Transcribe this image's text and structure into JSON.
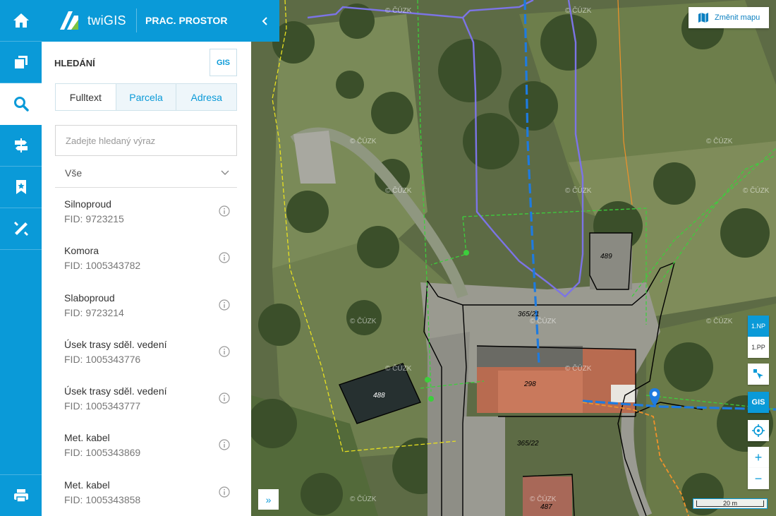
{
  "app": {
    "brand": "twiGIS",
    "workspace": "PRAC. PROSTOR"
  },
  "rail": [
    {
      "name": "home-icon"
    },
    {
      "name": "layers-icon"
    },
    {
      "name": "search-icon"
    },
    {
      "name": "signpost-icon"
    },
    {
      "name": "bookmark-icon"
    },
    {
      "name": "measure-icon"
    },
    {
      "name": "print-icon"
    }
  ],
  "panel": {
    "title": "HLEDÁNÍ",
    "gis_button": "GIS",
    "tabs": [
      "Fulltext",
      "Parcela",
      "Adresa"
    ],
    "search": {
      "placeholder": "Zadejte hledaný výraz",
      "value": ""
    },
    "filter": "Vše",
    "results": [
      {
        "title": "Silnoproud",
        "fid": "FID: 9723215"
      },
      {
        "title": "Komora",
        "fid": "FID: 1005343782"
      },
      {
        "title": "Slaboproud",
        "fid": "FID: 9723214"
      },
      {
        "title": "Úsek trasy sděl. vedení",
        "fid": "FID: 1005343776"
      },
      {
        "title": "Úsek trasy sděl. vedení",
        "fid": "FID: 1005343777"
      },
      {
        "title": "Met. kabel",
        "fid": "FID: 1005343869"
      },
      {
        "title": "Met. kabel",
        "fid": "FID: 1005343858"
      }
    ]
  },
  "map": {
    "change_map_label": "Změnit mapu",
    "floors": [
      "1.NP",
      "1.PP"
    ],
    "gis_label": "GIS",
    "zoom_in": "+",
    "zoom_out": "−",
    "expand": "»",
    "scale": "20 m",
    "watermark": "© ČÚZK",
    "parcels": [
      "489",
      "365/21",
      "298",
      "488",
      "365/22",
      "487"
    ],
    "colors": {
      "accent": "#0a9ad8",
      "utility_blue": "#1e7be0",
      "pipe_violet": "#7c74e6",
      "parcel_green": "#3ccf3c",
      "boundary_yellow": "#e8e020",
      "orange": "#f0922a"
    }
  }
}
